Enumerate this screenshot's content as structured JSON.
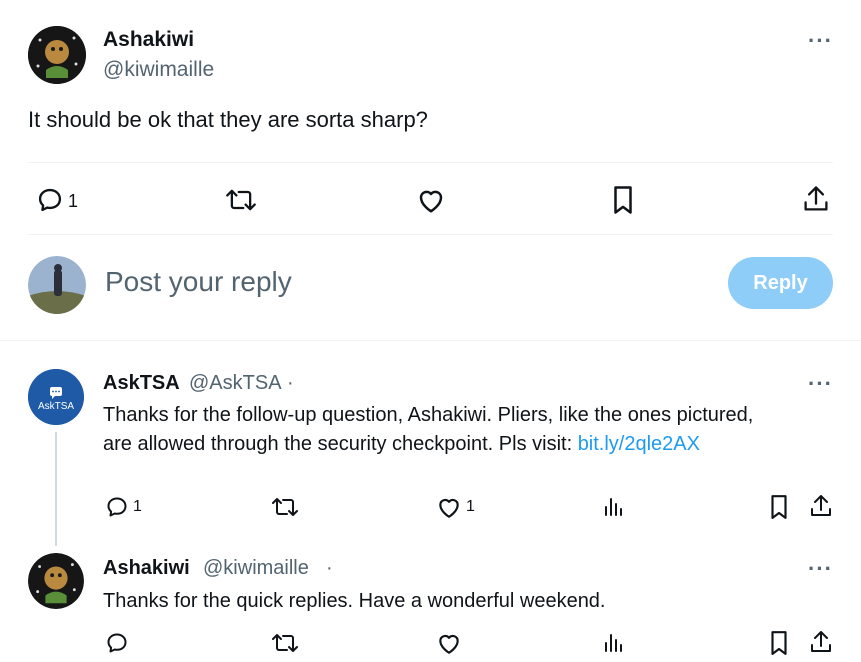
{
  "main_tweet": {
    "name": "Ashakiwi",
    "handle": "@kiwimaille",
    "text": "It should be ok that they are sorta sharp?",
    "reply_count": "1",
    "more_label": "···"
  },
  "composer": {
    "placeholder": "Post your reply",
    "button_label": "Reply"
  },
  "replies": [
    {
      "name": "AskTSA",
      "handle": "@AskTSA",
      "separator": "·",
      "avatar_text": "AskTSA",
      "text_line1": "Thanks for the follow-up question, Ashakiwi. Pliers, like the ones pictured,",
      "text_line2_prefix": "are allowed through the security checkpoint. Pls visit: ",
      "link": "bit.ly/2qle2AX",
      "reply_count": "1",
      "like_count": "1",
      "more_label": "···"
    },
    {
      "name": "Ashakiwi",
      "handle": "@kiwimaille",
      "separator": "·",
      "text": "Thanks for the quick replies. Have a wonderful weekend.",
      "more_label": "···"
    }
  ],
  "colors": {
    "accent": "#1d9bf0",
    "reply_button_disabled": "#8ecdf7",
    "secondary_text": "#536471",
    "tsa_blue": "#1f5aa6"
  }
}
